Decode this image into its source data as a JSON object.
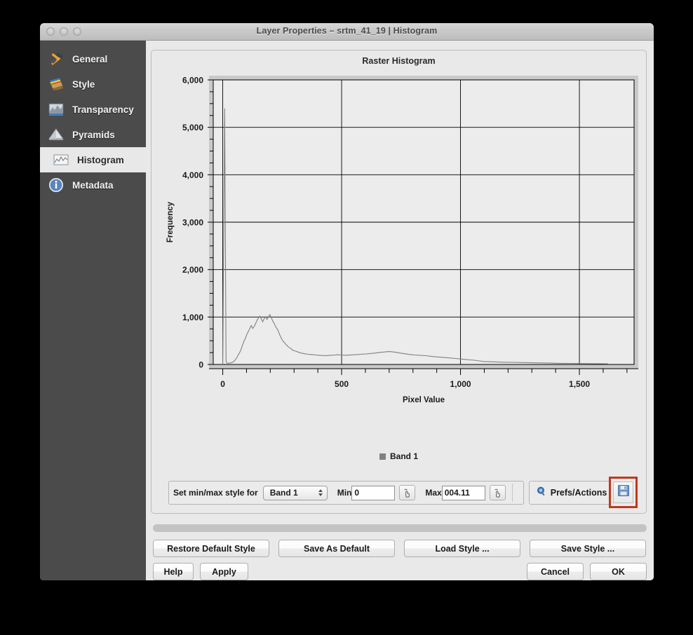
{
  "window": {
    "title": "Layer Properties – srtm_41_19 | Histogram",
    "traffic_lights": [
      "close",
      "minimize",
      "zoom"
    ]
  },
  "sidebar": {
    "items": [
      {
        "label": "General",
        "icon": "hammer-screwdriver-icon",
        "selected": false
      },
      {
        "label": "Style",
        "icon": "paintbrush-icon",
        "selected": false
      },
      {
        "label": "Transparency",
        "icon": "transparency-raster-icon",
        "selected": false
      },
      {
        "label": "Pyramids",
        "icon": "pyramids-icon",
        "selected": false
      },
      {
        "label": "Histogram",
        "icon": "histogram-icon",
        "selected": true
      },
      {
        "label": "Metadata",
        "icon": "info-circle-icon",
        "selected": false
      }
    ]
  },
  "chart_data": {
    "type": "line",
    "title": "Raster Histogram",
    "xlabel": "Pixel Value",
    "ylabel": "Frequency",
    "xlim": [
      -40,
      1730
    ],
    "ylim": [
      0,
      6000
    ],
    "xticks": [
      0,
      500,
      1000,
      1500
    ],
    "xtick_labels": [
      "0",
      "500",
      "1,000",
      "1,500"
    ],
    "yticks": [
      0,
      1000,
      2000,
      3000,
      4000,
      5000,
      6000
    ],
    "ytick_labels": [
      "0",
      "1,000",
      "2,000",
      "3,000",
      "4,000",
      "5,000",
      "6,000"
    ],
    "grid": true,
    "legend_position": "bottom",
    "series": [
      {
        "name": "Band 1",
        "color": "#808080",
        "x": [
          0,
          8,
          14,
          18,
          22,
          26,
          30,
          34,
          38,
          42,
          48,
          54,
          60,
          66,
          72,
          78,
          84,
          90,
          96,
          102,
          108,
          114,
          120,
          126,
          132,
          138,
          144,
          150,
          156,
          162,
          168,
          174,
          180,
          186,
          192,
          198,
          204,
          210,
          216,
          222,
          228,
          234,
          240,
          246,
          252,
          258,
          264,
          270,
          276,
          282,
          288,
          294,
          300,
          310,
          320,
          330,
          340,
          350,
          360,
          370,
          380,
          390,
          400,
          412,
          424,
          436,
          448,
          460,
          472,
          484,
          496,
          508,
          520,
          532,
          544,
          556,
          568,
          580,
          592,
          604,
          616,
          628,
          640,
          652,
          664,
          676,
          688,
          700,
          712,
          724,
          736,
          748,
          760,
          772,
          784,
          796,
          808,
          820,
          832,
          844,
          856,
          868,
          880,
          900,
          920,
          940,
          960,
          980,
          1000,
          1020,
          1040,
          1060,
          1080,
          1100,
          1140,
          1180,
          1220,
          1260,
          1300,
          1340,
          1380,
          1420,
          1460,
          1500,
          1540,
          1580,
          1620,
          1660,
          1700
        ],
        "y": [
          0,
          5400,
          60,
          30,
          25,
          28,
          30,
          34,
          40,
          48,
          70,
          110,
          150,
          210,
          260,
          330,
          420,
          500,
          560,
          640,
          700,
          760,
          820,
          760,
          800,
          860,
          930,
          980,
          1020,
          960,
          900,
          960,
          1010,
          950,
          1000,
          1050,
          990,
          920,
          870,
          800,
          760,
          700,
          620,
          560,
          500,
          470,
          430,
          400,
          370,
          350,
          330,
          300,
          290,
          275,
          255,
          240,
          230,
          220,
          215,
          210,
          205,
          200,
          195,
          190,
          188,
          186,
          190,
          195,
          200,
          205,
          200,
          196,
          194,
          198,
          202,
          206,
          210,
          214,
          218,
          222,
          228,
          234,
          240,
          248,
          256,
          262,
          268,
          272,
          268,
          260,
          250,
          240,
          230,
          220,
          212,
          206,
          200,
          196,
          192,
          188,
          184,
          176,
          168,
          160,
          152,
          144,
          136,
          126,
          116,
          106,
          96,
          88,
          74,
          62,
          54,
          48,
          44,
          40,
          36,
          32,
          28,
          24,
          22,
          20,
          18,
          16,
          14
        ]
      }
    ]
  },
  "minmax": {
    "set_label": "Set min/max style for",
    "band_selected": "Band 1",
    "band_options": [
      "Band 1"
    ],
    "min_label": "Min",
    "min_value": "0",
    "max_label": "Max",
    "max_value": "004.11",
    "pick_min_icon": "pick-hand-icon",
    "pick_max_icon": "pick-hand-icon",
    "prefs_label": "Prefs/Actions",
    "prefs_icon": "magnifier-icon",
    "prefs_arrow_icon": "chevron-down-icon",
    "save_icon": "floppy-disk-icon",
    "save_highlight_color": "#c0381a"
  },
  "buttons": {
    "restore_default_style": "Restore Default Style",
    "save_as_default": "Save As Default",
    "load_style": "Load Style ...",
    "save_style": "Save Style ...",
    "help": "Help",
    "apply": "Apply",
    "cancel": "Cancel",
    "ok": "OK"
  }
}
